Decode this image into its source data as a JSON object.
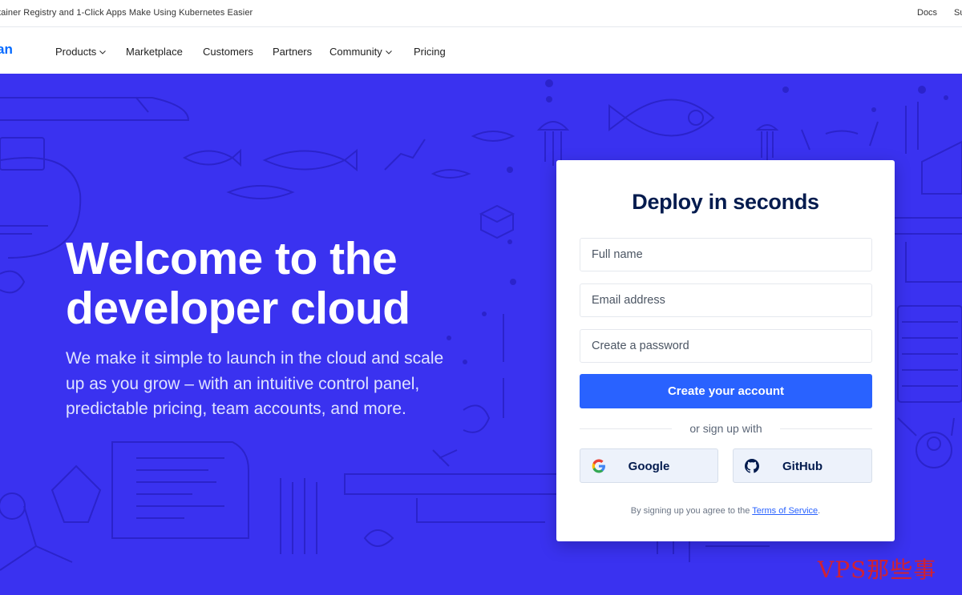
{
  "announcement": "tainer Registry and 1-Click Apps Make Using Kubernetes Easier",
  "top_links": {
    "docs": "Docs",
    "support": "Su"
  },
  "nav": {
    "logo": "an",
    "items": [
      {
        "label": "Products",
        "has_dropdown": true
      },
      {
        "label": "Marketplace",
        "has_dropdown": false
      },
      {
        "label": "Customers",
        "has_dropdown": false
      },
      {
        "label": "Partners",
        "has_dropdown": false
      },
      {
        "label": "Community",
        "has_dropdown": true
      },
      {
        "label": "Pricing",
        "has_dropdown": false
      }
    ]
  },
  "hero": {
    "title_line1": "Welcome to the",
    "title_line2": "developer cloud",
    "subtitle": "We make it simple to launch in the cloud and scale up as you grow – with an intuitive control panel, predictable pricing, team accounts, and more."
  },
  "signup": {
    "heading": "Deploy in seconds",
    "fields": {
      "full_name": {
        "placeholder": "Full name",
        "value": ""
      },
      "email": {
        "placeholder": "Email address",
        "value": ""
      },
      "password": {
        "placeholder": "Create a password",
        "value": ""
      }
    },
    "submit_label": "Create your account",
    "divider_text": "or sign up with",
    "google_label": "Google",
    "github_label": "GitHub",
    "terms_prefix": "By signing up you agree to the ",
    "terms_link": "Terms of Service",
    "terms_suffix": "."
  },
  "watermark": "VPS那些事",
  "colors": {
    "hero_bg": "#3a32f0",
    "primary_button": "#2962ff",
    "heading_text": "#031b4e",
    "brand": "#0069ff"
  }
}
